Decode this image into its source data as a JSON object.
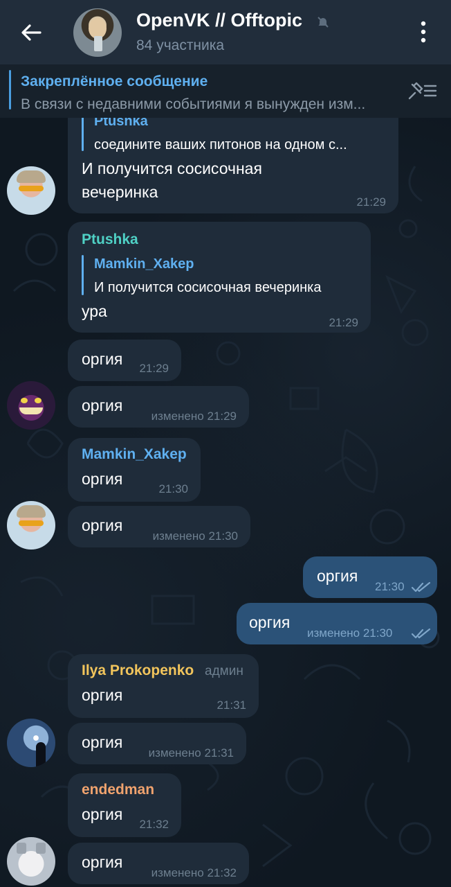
{
  "header": {
    "title": "OpenVK // Offtopic",
    "subtitle": "84 участника",
    "back_icon": "arrow-left-icon",
    "mute_icon": "muted-bell-icon",
    "more_icon": "vertical-dots-icon"
  },
  "pinned": {
    "title": "Закреплённое сообщение",
    "text": "В связи с недавними событиями я вынужден изм..."
  },
  "colors": {
    "header_bg": "#212d3b",
    "incoming_bubble": "#1f2c3a",
    "outgoing_bubble": "#2b5278",
    "accent": "#5fb0f0"
  },
  "messages": [
    {
      "reply_name": "Ptushka",
      "reply_text": "соедините ваших питонов на одном с...",
      "text_line1": "И получится сосисочная",
      "text_line2": "вечеринка",
      "time": "21:29"
    },
    {
      "sender": "Ptushka",
      "reply_name": "Mamkin_Xakep",
      "reply_text": "И получится сосисочная вечеринка",
      "text": "ура",
      "time": "21:29"
    },
    {
      "text": "оргия",
      "time": "21:29"
    },
    {
      "text": "оргия",
      "time": "изменено 21:29"
    },
    {
      "sender": "Mamkin_Xakep",
      "text": "оргия",
      "time": "21:30"
    },
    {
      "text": "оргия",
      "time": "изменено 21:30"
    },
    {
      "text": "оргия",
      "time": "21:30",
      "outgoing": true
    },
    {
      "text": "оргия",
      "time": "изменено 21:30",
      "outgoing": true
    },
    {
      "sender": "Ilya Prokopenko",
      "sender_tag": "админ",
      "text": "оргия",
      "time": "21:31"
    },
    {
      "text": "оргия",
      "time": "изменено 21:31"
    },
    {
      "sender": "endedman",
      "text": "оргия",
      "time": "21:32"
    },
    {
      "text": "оргия",
      "time": "изменено 21:32"
    }
  ]
}
